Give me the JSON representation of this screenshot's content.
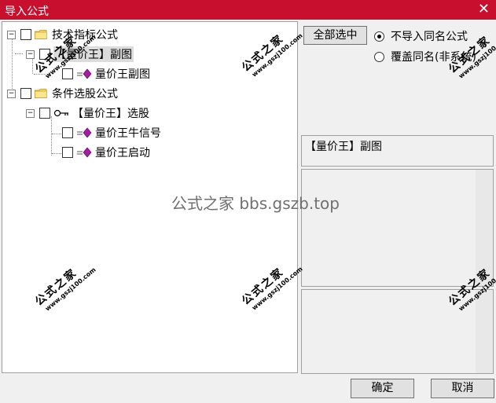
{
  "window": {
    "title": "导入公式",
    "close_glyph": "✕"
  },
  "tree": {
    "node_tech": "技术指标公式",
    "node_tech_child": "【量价王】副图",
    "node_tech_leaf": "量价王副图",
    "node_cond": "条件选股公式",
    "node_cond_child": "【量价王】选股",
    "node_cond_leaf1": "量价王牛信号",
    "node_cond_leaf2": "量价王启动"
  },
  "right": {
    "select_all_label": "全部选中",
    "radio_skip_label": "不导入同名公式",
    "radio_overwrite_label": "覆盖同名(非系统)",
    "radio_selected": "skip",
    "selected_name": "【量价王】副图"
  },
  "buttons": {
    "ok": "确定",
    "cancel": "取消"
  },
  "watermark": {
    "cn": "公式之家",
    "en": "www.gszj100.com",
    "center": "公式之家 bbs.gszb.top"
  }
}
